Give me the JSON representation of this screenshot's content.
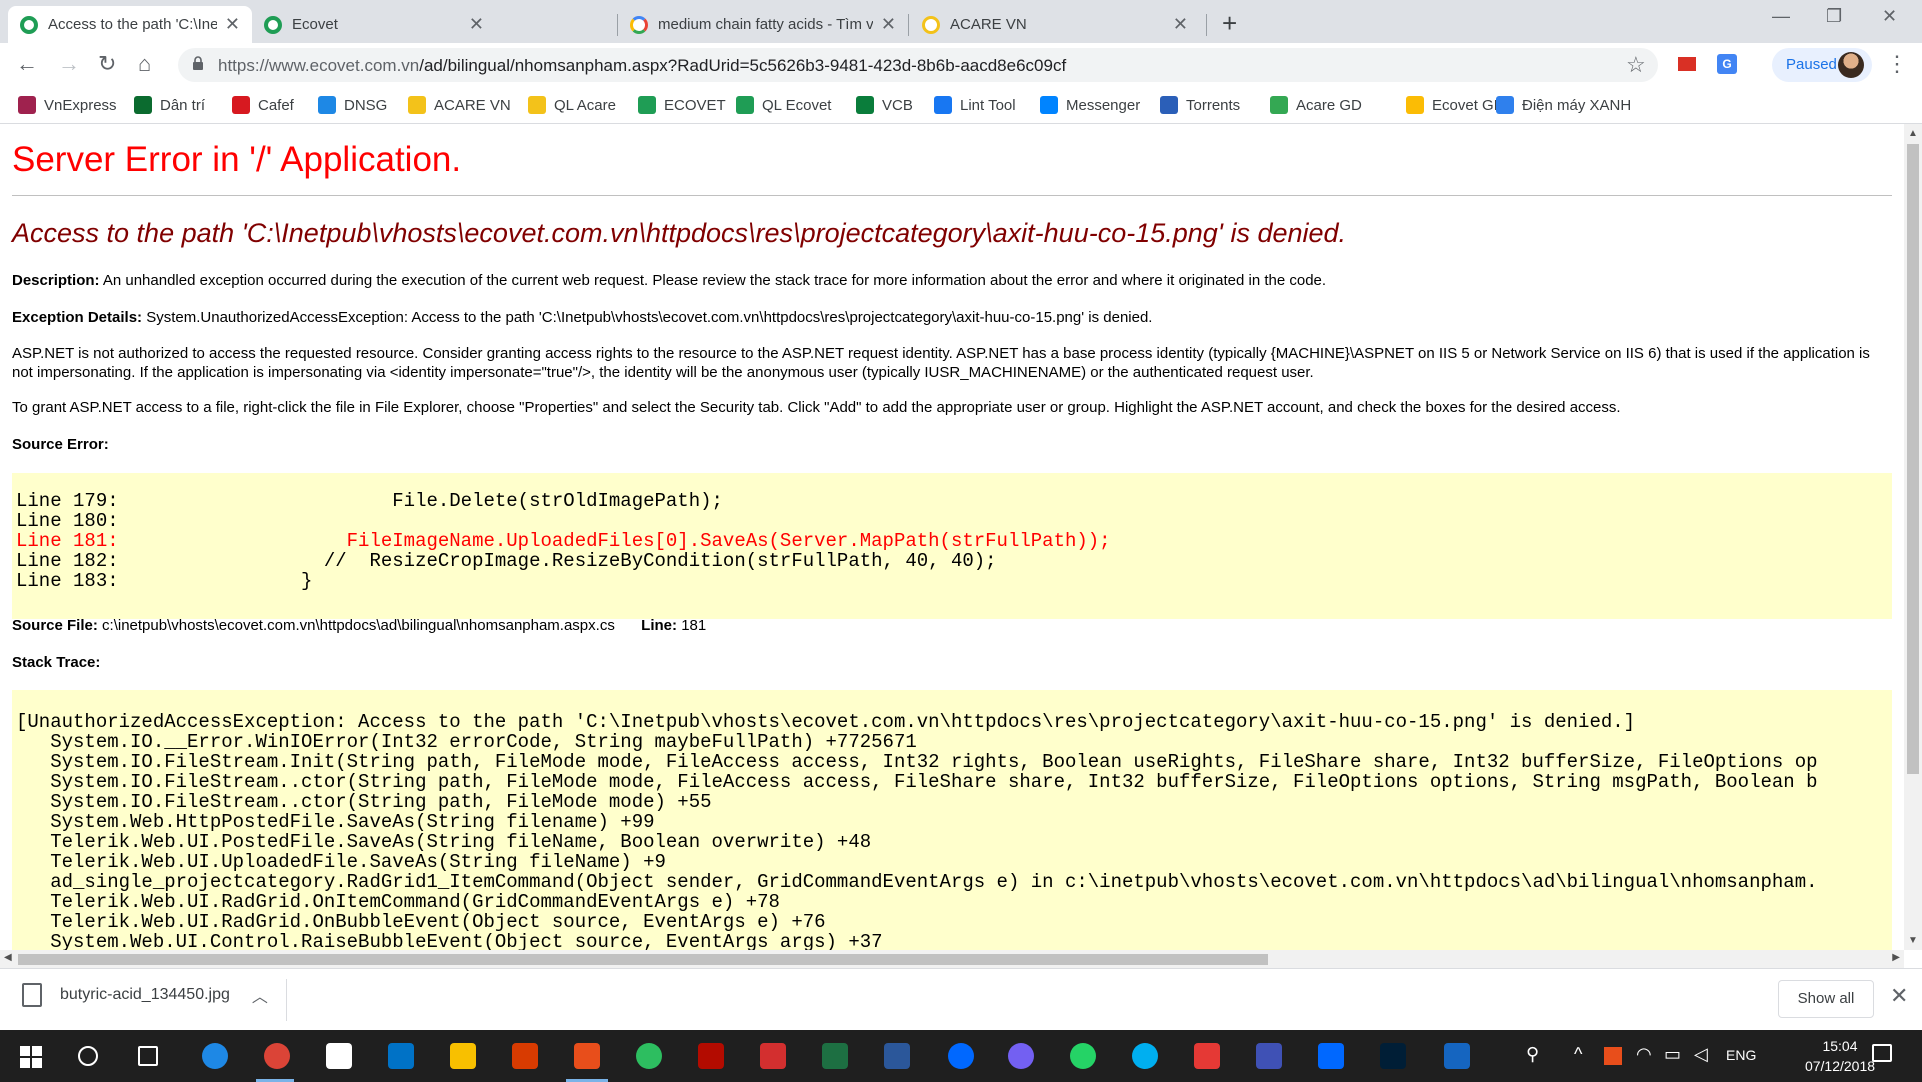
{
  "browser": {
    "tabs": [
      {
        "title": "Access to the path 'C:\\Inetpub\\vh",
        "active": true,
        "icon": "ecovet-icon"
      },
      {
        "title": "Ecovet",
        "active": false,
        "icon": "ecovet-icon"
      },
      {
        "title": "medium chain fatty acids - Tìm vớ",
        "active": false,
        "icon": "google-icon"
      },
      {
        "title": "ACARE VN",
        "active": false,
        "icon": "acare-icon"
      }
    ],
    "url_host": "https://www.ecovet.com.vn",
    "url_path": "/ad/bilingual/nhomsanpham.aspx?RadUrid=5c5626b3-9481-423d-8b6b-aacd8e6c09cf",
    "profile_label": "Paused",
    "translate_label": "G"
  },
  "bookmarks": [
    {
      "label": "VnExpress",
      "color": "#9f224e"
    },
    {
      "label": "Dân trí",
      "color": "#0b6b2f"
    },
    {
      "label": "Cafef",
      "color": "#d71920"
    },
    {
      "label": "DNSG",
      "color": "#1e88e5"
    },
    {
      "label": "ACARE VN",
      "color": "#f3c21a"
    },
    {
      "label": "QL Acare",
      "color": "#f3c21a"
    },
    {
      "label": "ECOVET",
      "color": "#1f9d55"
    },
    {
      "label": "QL Ecovet",
      "color": "#1f9d55"
    },
    {
      "label": "VCB",
      "color": "#0a7d3b"
    },
    {
      "label": "Lint Tool",
      "color": "#1877f2"
    },
    {
      "label": "Messenger",
      "color": "#0084ff"
    },
    {
      "label": "Torrents",
      "color": "#2b5fb8"
    },
    {
      "label": "Acare GD",
      "color": "#34a853"
    },
    {
      "label": "Ecovet GD",
      "color": "#fbbc05"
    },
    {
      "label": "Điện máy XANH",
      "color": "#2f80ed"
    }
  ],
  "error": {
    "title": "Server Error in '/' Application.",
    "heading": "Access to the path 'C:\\Inetpub\\vhosts\\ecovet.com.vn\\httpdocs\\res\\projectcategory\\axit-huu-co-15.png' is denied.",
    "description_label": "Description:",
    "description_text": "An unhandled exception occurred during the execution of the current web request. Please review the stack trace for more information about the error and where it originated in the code.",
    "exception_label": "Exception Details:",
    "exception_text": "System.UnauthorizedAccessException: Access to the path 'C:\\Inetpub\\vhosts\\ecovet.com.vn\\httpdocs\\res\\projectcategory\\axit-huu-co-15.png' is denied.",
    "aspnet_note": "ASP.NET is not authorized to access the requested resource. Consider granting access rights to the resource to the ASP.NET request identity. ASP.NET has a base process identity (typically {MACHINE}\\ASPNET on IIS 5 or Network Service on IIS 6) that is used if the application is not impersonating. If the application is impersonating via <identity impersonate=\"true\"/>, the identity will be the anonymous user (typically IUSR_MACHINENAME) or the authenticated request user.",
    "grant_note": "To grant ASP.NET access to a file, right-click the file in File Explorer, choose \"Properties\" and select the Security tab. Click \"Add\" to add the appropriate user or group. Highlight the ASP.NET account, and check the boxes for the desired access.",
    "source_error_label": "Source Error:",
    "source_lines": [
      {
        "text": "Line 179:                        File.Delete(strOldImagePath);",
        "error": false
      },
      {
        "text": "Line 180:",
        "error": false
      },
      {
        "text": "Line 181:                    FileImageName.UploadedFiles[0].SaveAs(Server.MapPath(strFullPath));",
        "error": true
      },
      {
        "text": "Line 182:                  //  ResizeCropImage.ResizeByCondition(strFullPath, 40, 40);",
        "error": false
      },
      {
        "text": "Line 183:                }",
        "error": false
      }
    ],
    "source_file_label": "Source File:",
    "source_file": "c:\\inetpub\\vhosts\\ecovet.com.vn\\httpdocs\\ad\\bilingual\\nhomsanpham.aspx.cs",
    "line_label": "Line:",
    "line_number": "181",
    "stack_trace_label": "Stack Trace:",
    "stack_lines": [
      "[UnauthorizedAccessException: Access to the path 'C:\\Inetpub\\vhosts\\ecovet.com.vn\\httpdocs\\res\\projectcategory\\axit-huu-co-15.png' is denied.]",
      "   System.IO.__Error.WinIOError(Int32 errorCode, String maybeFullPath) +7725671",
      "   System.IO.FileStream.Init(String path, FileMode mode, FileAccess access, Int32 rights, Boolean useRights, FileShare share, Int32 bufferSize, FileOptions op",
      "   System.IO.FileStream..ctor(String path, FileMode mode, FileAccess access, FileShare share, Int32 bufferSize, FileOptions options, String msgPath, Boolean b",
      "   System.IO.FileStream..ctor(String path, FileMode mode) +55",
      "   System.Web.HttpPostedFile.SaveAs(String filename) +99",
      "   Telerik.Web.UI.PostedFile.SaveAs(String fileName, Boolean overwrite) +48",
      "   Telerik.Web.UI.UploadedFile.SaveAs(String fileName) +9",
      "   ad_single_projectcategory.RadGrid1_ItemCommand(Object sender, GridCommandEventArgs e) in c:\\inetpub\\vhosts\\ecovet.com.vn\\httpdocs\\ad\\bilingual\\nhomsanpham.",
      "   Telerik.Web.UI.RadGrid.OnItemCommand(GridCommandEventArgs e) +78",
      "   Telerik.Web.UI.RadGrid.OnBubbleEvent(Object source, EventArgs e) +76",
      "   System.Web.UI.Control.RaiseBubbleEvent(Object source, EventArgs args) +37"
    ]
  },
  "download": {
    "filename": "butyric-acid_134450.jpg",
    "show_all_label": "Show all"
  },
  "taskbar": {
    "language": "ENG",
    "time": "15:04",
    "date": "07/12/2018",
    "apps": [
      {
        "name": "search-icon",
        "color": "#1f1f1f"
      },
      {
        "name": "task-view-icon",
        "color": "#1f1f1f"
      },
      {
        "name": "edge-icon",
        "color": "#1e88e5"
      },
      {
        "name": "chrome-icon",
        "color": "#db4437"
      },
      {
        "name": "calendar-icon",
        "color": "#ffffff"
      },
      {
        "name": "outlook-icon",
        "color": "#0072c6"
      },
      {
        "name": "file-explorer-icon",
        "color": "#f8c000"
      },
      {
        "name": "office-icon",
        "color": "#d83b01"
      },
      {
        "name": "snagit-icon",
        "color": "#e84e1b"
      },
      {
        "name": "evernote-icon",
        "color": "#2dbe60"
      },
      {
        "name": "acrobat-icon",
        "color": "#b30b00"
      },
      {
        "name": "wps-icon",
        "color": "#d32f2f"
      },
      {
        "name": "excel-icon",
        "color": "#1d6f42"
      },
      {
        "name": "word-icon",
        "color": "#2b579a"
      },
      {
        "name": "zalo-icon",
        "color": "#0068ff"
      },
      {
        "name": "viber-icon",
        "color": "#7360f2"
      },
      {
        "name": "whatsapp-icon",
        "color": "#25d366"
      },
      {
        "name": "skype-icon",
        "color": "#00aff0"
      },
      {
        "name": "pdf-editor-icon",
        "color": "#e53935"
      },
      {
        "name": "save-disk-icon",
        "color": "#3f51b5"
      },
      {
        "name": "zalo-chat-icon",
        "color": "#0068ff"
      },
      {
        "name": "photoshop-icon",
        "color": "#001e36"
      },
      {
        "name": "screenshot-icon",
        "color": "#1565c0"
      }
    ]
  }
}
